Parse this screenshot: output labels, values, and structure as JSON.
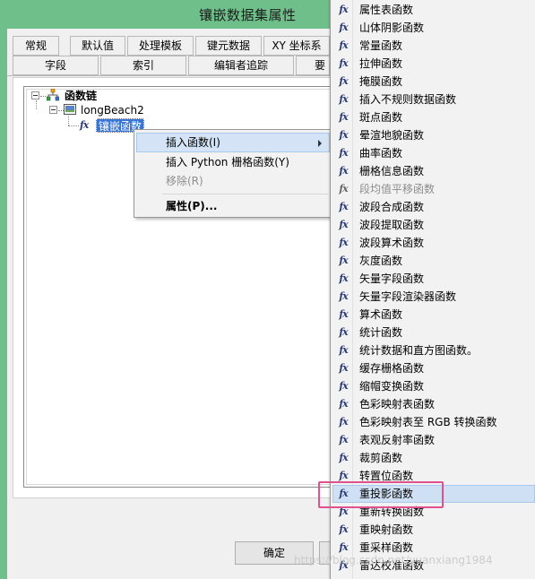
{
  "window": {
    "title": "镶嵌数据集属性"
  },
  "tabs_row1": [
    "常规",
    "默认值",
    "处理模板",
    "键元数据",
    "XY 坐标系"
  ],
  "tabs_row2": [
    "字段",
    "索引",
    "编辑者追踪",
    "要"
  ],
  "tree": {
    "root": "函数链",
    "child": "longBeach2",
    "leaf": "镶嵌函数"
  },
  "context_menu": {
    "items": [
      {
        "label": "插入函数(I)",
        "has_submenu": true,
        "state": "hover"
      },
      {
        "label": "插入 Python 栅格函数(Y)",
        "state": "normal"
      },
      {
        "label": "移除(R)",
        "state": "disabled"
      },
      {
        "label": "属性(P)...",
        "state": "bold"
      }
    ]
  },
  "submenu": {
    "items": [
      "属性表函数",
      "山体阴影函数",
      "常量函数",
      "拉伸函数",
      "掩膜函数",
      "插入不规则数据函数",
      "斑点函数",
      "晕渲地貌函数",
      "曲率函数",
      "栅格信息函数",
      "段均值平移函数",
      "波段合成函数",
      "波段提取函数",
      "波段算术函数",
      "灰度函数",
      "矢量字段函数",
      "矢量字段渲染器函数",
      "算术函数",
      "统计函数",
      "统计数据和直方图函数。",
      "缓存栅格函数",
      "缩帽变换函数",
      "色彩映射表函数",
      "色彩映射表至 RGB 转换函数",
      "表观反射率函数",
      "裁剪函数",
      "转置位函数",
      "重投影函数",
      "重新转换函数",
      "重映射函数",
      "重采样函数",
      "雷达校准函数"
    ],
    "disabled_index": 10,
    "hover_index": 27
  },
  "buttons": {
    "ok": "确定"
  },
  "watermark": "https://blog.csdn.net/yuanxiang1984",
  "colors": {
    "titlebar": "#6fbf8a",
    "menu_hover": "#cfe0f4",
    "highlight": "#e0528d"
  },
  "icons": {
    "function": "fx-icon",
    "chain": "function-chain-icon",
    "dataset": "raster-dataset-icon"
  }
}
